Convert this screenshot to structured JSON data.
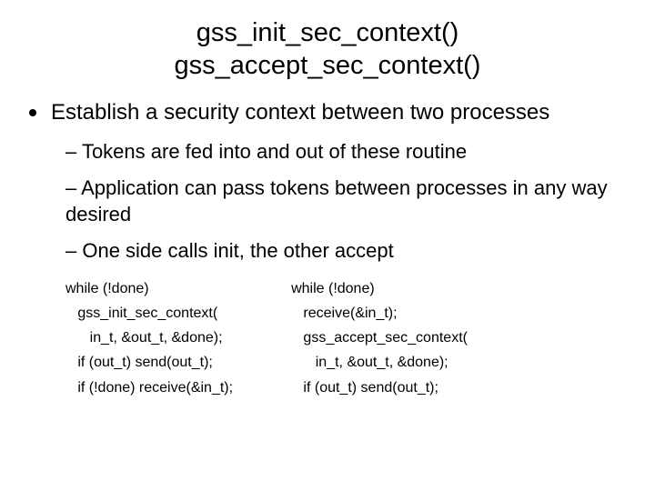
{
  "title_line1": "gss_init_sec_context()",
  "title_line2": "gss_accept_sec_context()",
  "main_bullet": "Establish a security context between two processes",
  "sub1": "– Tokens are fed into and out of these routine",
  "sub2": "– Application can pass tokens between processes in any way desired",
  "sub3": "– One side calls init, the other accept",
  "code_left": "while (!done)\n   gss_init_sec_context(\n      in_t, &out_t, &done);\n   if (out_t) send(out_t);\n   if (!done) receive(&in_t);",
  "code_right": "while (!done)\n   receive(&in_t);\n   gss_accept_sec_context(\n      in_t, &out_t, &done);\n   if (out_t) send(out_t);"
}
